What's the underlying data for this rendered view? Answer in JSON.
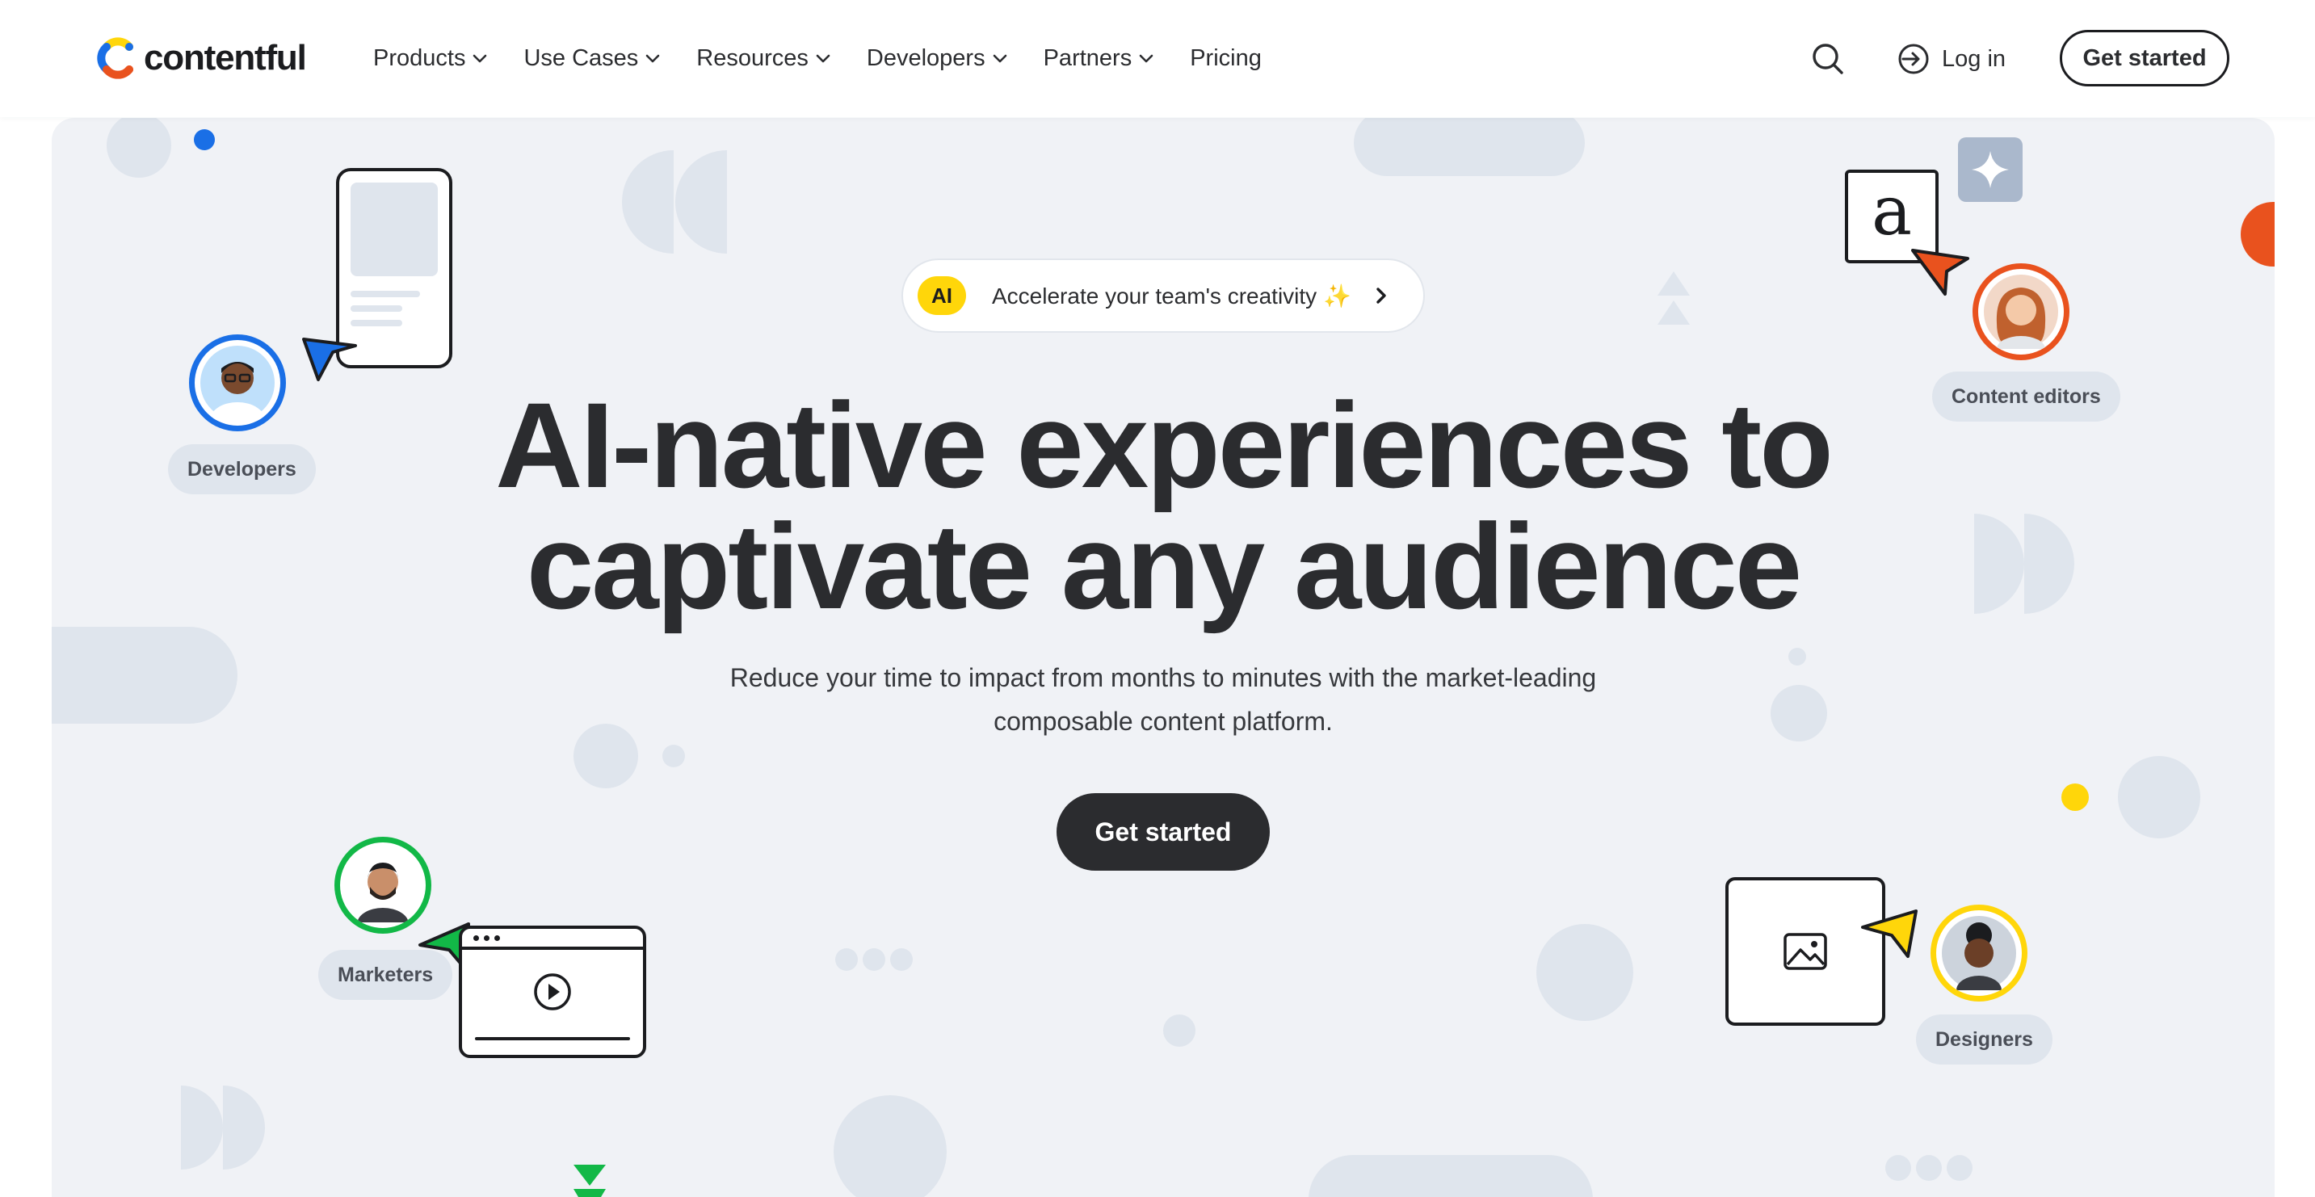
{
  "brand": {
    "name": "contentful"
  },
  "nav": {
    "items": [
      {
        "label": "Products",
        "has_dropdown": true
      },
      {
        "label": "Use Cases",
        "has_dropdown": true
      },
      {
        "label": "Resources",
        "has_dropdown": true
      },
      {
        "label": "Developers",
        "has_dropdown": true
      },
      {
        "label": "Partners",
        "has_dropdown": true
      },
      {
        "label": "Pricing",
        "has_dropdown": false
      }
    ],
    "search_icon": "search-icon",
    "login_label": "Log in",
    "cta_label": "Get started"
  },
  "hero": {
    "announcement": {
      "badge": "AI",
      "text": "Accelerate your team's creativity ✨"
    },
    "headline_line1": "AI-native experiences to",
    "headline_line2": "captivate any audience",
    "subline_line1": "Reduce your time to impact from months to minutes with the market-leading",
    "subline_line2": "composable content platform.",
    "cta_label": "Get started",
    "personas": [
      {
        "label": "Developers",
        "color": "#1a6fe6"
      },
      {
        "label": "Content editors",
        "color": "#e9521e"
      },
      {
        "label": "Marketers",
        "color": "#12b847"
      },
      {
        "label": "Designers",
        "color": "#ffd60a"
      }
    ],
    "card_letter": "a"
  },
  "colors": {
    "text": "#2b2c2f",
    "hero_bg": "#f0f2f6",
    "shape": "#dfe5ed",
    "blue": "#1a6fe6",
    "orange": "#e9521e",
    "green": "#12b847",
    "yellow": "#ffd60a"
  }
}
